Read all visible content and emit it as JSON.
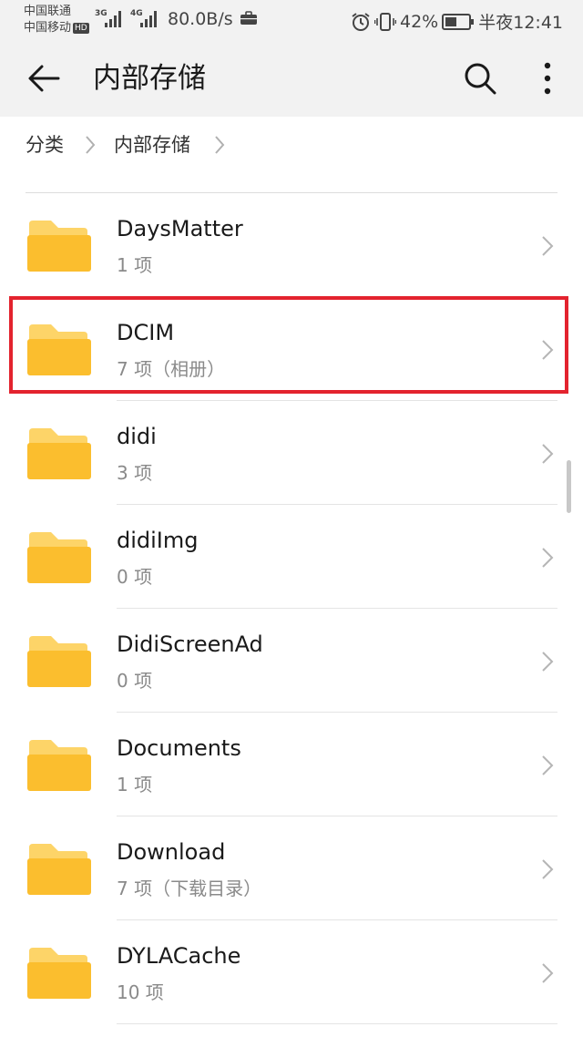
{
  "status_bar": {
    "carrier_1": "中国联通",
    "carrier_2": "中国移动",
    "hd_badge": "HD",
    "signal_1_type": "3G",
    "signal_2_type": "4G",
    "net_speed": "80.0B/s",
    "battery_percent": "42%",
    "time": "半夜12:41",
    "icons": [
      "briefcase-icon",
      "alarm-icon",
      "vibrate-icon",
      "battery-icon"
    ]
  },
  "app_bar": {
    "title": "内部存储",
    "back_icon": "arrow-left-icon",
    "search_icon": "search-icon",
    "more_icon": "more-vertical-icon"
  },
  "breadcrumb": {
    "items": [
      "分类",
      "内部存储"
    ]
  },
  "files": [
    {
      "name": "DaysMatter",
      "meta": "1 项"
    },
    {
      "name": "DCIM",
      "meta": "7 项（相册）"
    },
    {
      "name": "didi",
      "meta": "3 项"
    },
    {
      "name": "didiImg",
      "meta": "0 项"
    },
    {
      "name": "DidiScreenAd",
      "meta": "0 项"
    },
    {
      "name": "Documents",
      "meta": "1 项"
    },
    {
      "name": "Download",
      "meta": "7 项（下载目录）"
    },
    {
      "name": "DYLACache",
      "meta": "10 项"
    }
  ],
  "highlighted_item": "DCIM",
  "colors": {
    "folder": "#FBBE2E",
    "folder_tab": "#FDD468",
    "highlight": "#E3232E",
    "bar_bg": "#F2F2F2"
  }
}
